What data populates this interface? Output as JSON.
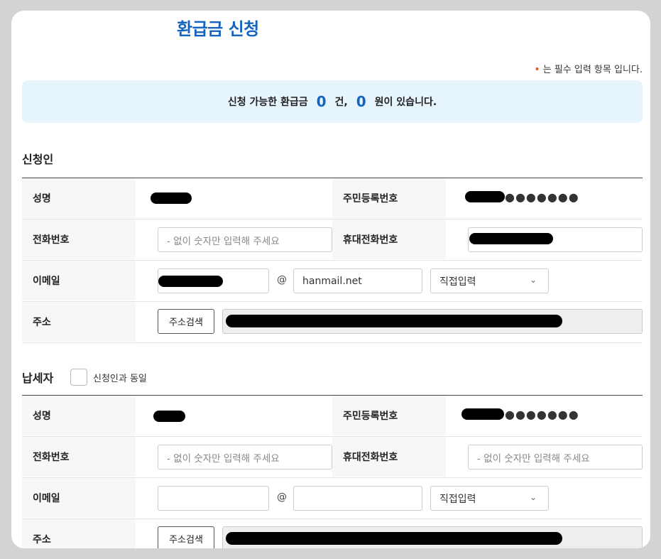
{
  "page": {
    "title": "환급금 신청",
    "required_note": "는 필수 입력 항목 입니다.",
    "banner": {
      "prefix": "신청 가능한 환급금",
      "count": "0",
      "count_unit": "건,",
      "amount": "0",
      "amount_suffix": "원이 있습니다."
    }
  },
  "applicant": {
    "section_title": "신청인",
    "name_label": "성명",
    "rrn_label": "주민등록번호",
    "rrn_mask": "●●●●●●●",
    "phone_label": "전화번호",
    "phone_placeholder": "- 없이 숫자만 입력해 주세요",
    "mobile_label": "휴대전화번호",
    "email_label": "이메일",
    "email_at": "@",
    "email_domain": "hanmail.net",
    "email_domain_select": "직접입력",
    "address_label": "주소",
    "address_search_button": "주소검색"
  },
  "taxpayer": {
    "section_title": "납세자",
    "same_as_applicant_label": "신청인과 동일",
    "same_as_applicant_checked": false,
    "name_label": "성명",
    "rrn_label": "주민등록번호",
    "rrn_mask": "●●●●●●●",
    "phone_label": "전화번호",
    "phone_placeholder": "- 없이 숫자만 입력해 주세요",
    "mobile_label": "휴대전화번호",
    "mobile_placeholder": "- 없이 숫자만 입력해 주세요",
    "email_label": "이메일",
    "email_at": "@",
    "email_domain": "",
    "email_domain_select": "직접입력",
    "address_label": "주소",
    "address_search_button": "주소검색"
  },
  "icons": {
    "select_chevron": "chevron-down-icon",
    "required_dot": "required-dot-icon"
  },
  "colors": {
    "accent": "#1565c0",
    "required": "#e8551f",
    "banner_bg": "#e6f4fb"
  }
}
